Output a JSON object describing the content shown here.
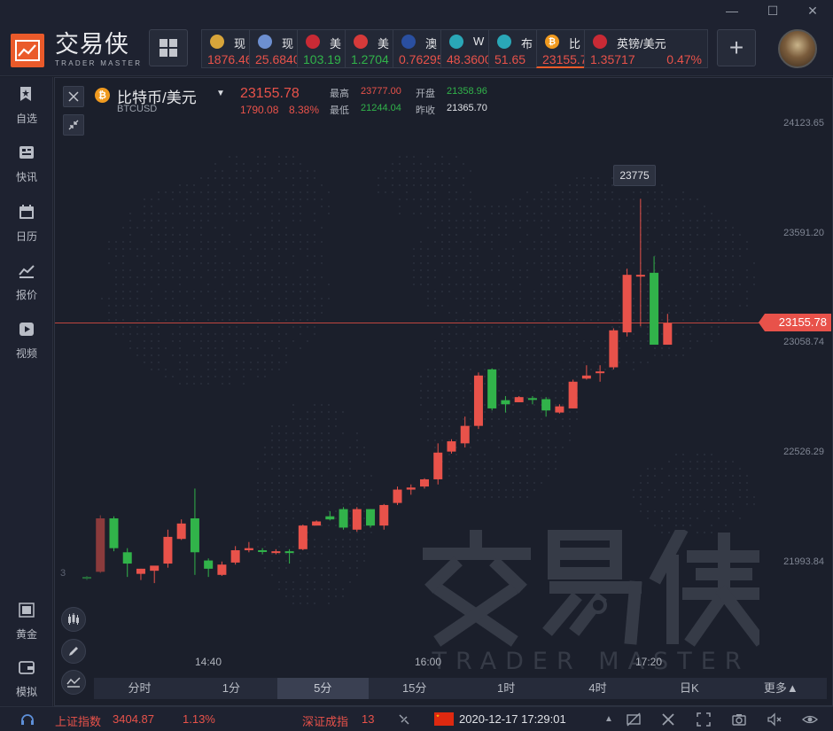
{
  "brand": {
    "name_cn": "交易侠",
    "name_en": "TRADER MASTER"
  },
  "tickers": [
    {
      "name": "现",
      "price": "1876.46",
      "change": "",
      "icon": "gold-coin-icon",
      "color": "#d8a53a",
      "dir": "up"
    },
    {
      "name": "现",
      "price": "25.6840",
      "change": "",
      "icon": "silver-coin-icon",
      "color": "#6d8fd0",
      "dir": "up"
    },
    {
      "name": "美",
      "price": "103.19",
      "change": "",
      "icon": "us-japan-flag-icon",
      "color": "#c92a35",
      "dir": "down"
    },
    {
      "name": "美",
      "price": "1.2704",
      "change": "",
      "icon": "us-canada-flag-icon",
      "color": "#d63a3a",
      "dir": "down"
    },
    {
      "name": "澳",
      "price": "0.76295",
      "change": "",
      "icon": "australia-flag-icon",
      "color": "#2a4fa0",
      "dir": "up"
    },
    {
      "name": "W",
      "price": "48.3600",
      "change": "",
      "icon": "oil-barrel-icon",
      "color": "#2aa7b7",
      "dir": "up"
    },
    {
      "name": "布",
      "price": "51.65",
      "change": "",
      "icon": "oil-barrel-icon",
      "color": "#2aa7b7",
      "dir": "up"
    },
    {
      "name": "比",
      "price": "23155.7",
      "change": "",
      "icon": "bitcoin-icon",
      "color": "#f09a1f",
      "dir": "up"
    },
    {
      "name": "英镑/美元",
      "price": "1.35717",
      "change": "0.47%",
      "icon": "uk-flag-icon",
      "color": "#c92a35",
      "dir": "up"
    }
  ],
  "sidebar": [
    {
      "label": "自选",
      "icon": "star-bookmark-icon"
    },
    {
      "label": "快讯",
      "icon": "newsflash-icon"
    },
    {
      "label": "日历",
      "icon": "calendar-icon"
    },
    {
      "label": "报价",
      "icon": "quote-line-icon"
    },
    {
      "label": "视频",
      "icon": "video-play-icon"
    },
    {
      "label": "黄金",
      "icon": "gold-icon"
    },
    {
      "label": "模拟",
      "icon": "wallet-icon"
    }
  ],
  "symbol": {
    "name": "比特币/美元",
    "code": "BTCUSD",
    "price": "23155.78",
    "change": "1790.08",
    "change_pct": "8.38%",
    "high_label": "最高",
    "high": "23777.00",
    "low_label": "最低",
    "low": "21244.04",
    "open_label": "开盘",
    "open": "21358.96",
    "prev_label": "昨收",
    "prev_close": "21365.70"
  },
  "price_axis": [
    "24123.65",
    "23591.20",
    "23058.74",
    "22526.29",
    "21993.84"
  ],
  "current_price_tag": "23155.78",
  "peak_label": "23775",
  "left_edge_label": "3",
  "time_axis": [
    "14:40",
    "16:00",
    "17:20"
  ],
  "timeframes": [
    "分时",
    "1分",
    "5分",
    "15分",
    "1时",
    "4时",
    "日K",
    "更多▲"
  ],
  "active_timeframe": "5分",
  "status": {
    "index1_name": "上证指数",
    "index1_value": "3404.87",
    "index1_pct": "1.13%",
    "index2_name": "深证成指",
    "index2_value": "13",
    "datetime": "2020-12-17 17:29:01"
  },
  "colors": {
    "up": "#e8524a",
    "down": "#31b34a",
    "accent": "#ea5a2a",
    "bg": "#1b1f2a"
  },
  "chart_data": {
    "type": "candlestick",
    "symbol": "BTCUSD",
    "interval": "5分",
    "ylim": [
      21800,
      24300
    ],
    "y_ticks": [
      21993.84,
      22526.29,
      23058.74,
      23591.2,
      24123.65
    ],
    "x_ticks": [
      "14:40",
      "16:00",
      "17:20"
    ],
    "current_price": 23155.78,
    "peak_annotation": 23775,
    "candles": [
      {
        "o": 21920,
        "h": 21925,
        "l": 21905,
        "c": 21915
      },
      {
        "o": 21945,
        "h": 22220,
        "l": 21940,
        "c": 22205
      },
      {
        "o": 22205,
        "h": 22215,
        "l": 22045,
        "c": 22060
      },
      {
        "o": 22040,
        "h": 22060,
        "l": 21920,
        "c": 21985
      },
      {
        "o": 21935,
        "h": 21960,
        "l": 21905,
        "c": 21960
      },
      {
        "o": 21950,
        "h": 21960,
        "l": 21890,
        "c": 21975
      },
      {
        "o": 21985,
        "h": 22150,
        "l": 21965,
        "c": 22115
      },
      {
        "o": 22105,
        "h": 22200,
        "l": 22100,
        "c": 22180
      },
      {
        "o": 22205,
        "h": 22350,
        "l": 21930,
        "c": 22040
      },
      {
        "o": 22000,
        "h": 22010,
        "l": 21920,
        "c": 21960
      },
      {
        "o": 21930,
        "h": 21995,
        "l": 21925,
        "c": 21980
      },
      {
        "o": 21990,
        "h": 22070,
        "l": 21980,
        "c": 22050
      },
      {
        "o": 22050,
        "h": 22090,
        "l": 22040,
        "c": 22060
      },
      {
        "o": 22050,
        "h": 22060,
        "l": 22030,
        "c": 22045
      },
      {
        "o": 22040,
        "h": 22055,
        "l": 22030,
        "c": 22045
      },
      {
        "o": 22045,
        "h": 22055,
        "l": 21985,
        "c": 22040
      },
      {
        "o": 22055,
        "h": 22175,
        "l": 22050,
        "c": 22170
      },
      {
        "o": 22170,
        "h": 22195,
        "l": 22170,
        "c": 22190
      },
      {
        "o": 22215,
        "h": 22240,
        "l": 22195,
        "c": 22200
      },
      {
        "o": 22250,
        "h": 22260,
        "l": 22150,
        "c": 22160
      },
      {
        "o": 22150,
        "h": 22260,
        "l": 22140,
        "c": 22250
      },
      {
        "o": 22250,
        "h": 22250,
        "l": 22160,
        "c": 22170
      },
      {
        "o": 22170,
        "h": 22275,
        "l": 22150,
        "c": 22270
      },
      {
        "o": 22280,
        "h": 22360,
        "l": 22270,
        "c": 22345
      },
      {
        "o": 22345,
        "h": 22370,
        "l": 22320,
        "c": 22355
      },
      {
        "o": 22360,
        "h": 22400,
        "l": 22350,
        "c": 22395
      },
      {
        "o": 22395,
        "h": 22570,
        "l": 22370,
        "c": 22525
      },
      {
        "o": 22530,
        "h": 22590,
        "l": 22520,
        "c": 22580
      },
      {
        "o": 22570,
        "h": 22700,
        "l": 22550,
        "c": 22655
      },
      {
        "o": 22655,
        "h": 22915,
        "l": 22640,
        "c": 22900
      },
      {
        "o": 22930,
        "h": 22935,
        "l": 22730,
        "c": 22740
      },
      {
        "o": 22780,
        "h": 22800,
        "l": 22720,
        "c": 22760
      },
      {
        "o": 22770,
        "h": 22800,
        "l": 22770,
        "c": 22795
      },
      {
        "o": 22790,
        "h": 22800,
        "l": 22760,
        "c": 22785
      },
      {
        "o": 22785,
        "h": 22795,
        "l": 22700,
        "c": 22730
      },
      {
        "o": 22720,
        "h": 22760,
        "l": 22715,
        "c": 22750
      },
      {
        "o": 22740,
        "h": 22880,
        "l": 22740,
        "c": 22870
      },
      {
        "o": 22885,
        "h": 22950,
        "l": 22880,
        "c": 22900
      },
      {
        "o": 22915,
        "h": 22950,
        "l": 22870,
        "c": 22920
      },
      {
        "o": 22940,
        "h": 23130,
        "l": 22930,
        "c": 23120
      },
      {
        "o": 23110,
        "h": 23420,
        "l": 23090,
        "c": 23390
      },
      {
        "o": 23390,
        "h": 23760,
        "l": 23140,
        "c": 23390
      },
      {
        "o": 23400,
        "h": 23480,
        "l": 23050,
        "c": 23050
      },
      {
        "o": 23050,
        "h": 23200,
        "l": 23050,
        "c": 23155
      }
    ]
  }
}
